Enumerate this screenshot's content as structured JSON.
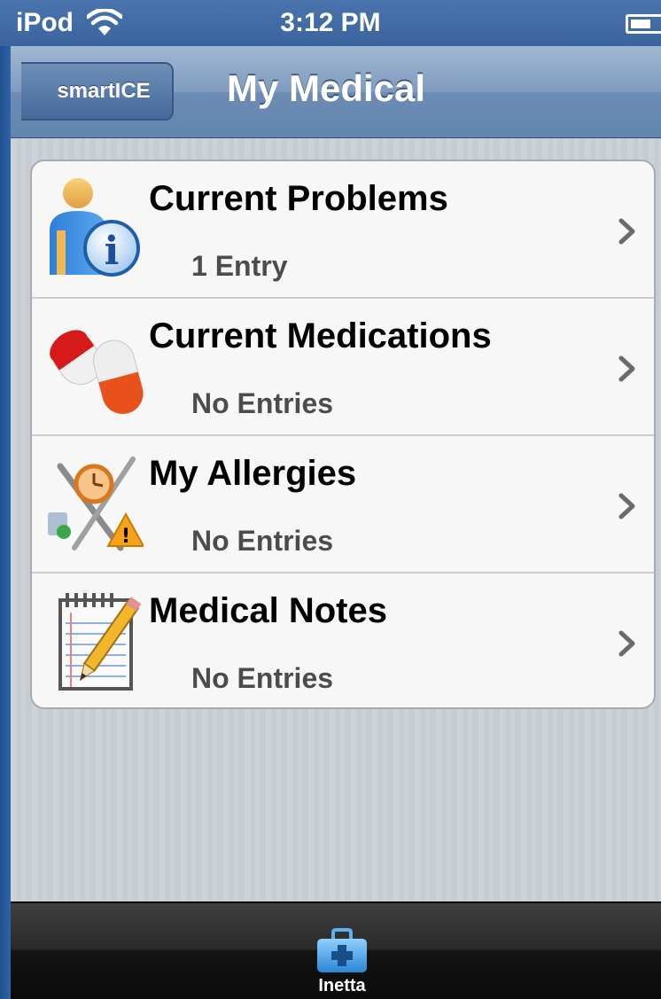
{
  "status_bar": {
    "carrier": "iPod",
    "time": "3:12 PM"
  },
  "nav": {
    "back_label": "smartICE",
    "title": "My Medical"
  },
  "rows": [
    {
      "title": "Current Problems",
      "subtitle": "1 Entry",
      "icon": "person-info-icon"
    },
    {
      "title": "Current Medications",
      "subtitle": "No Entries",
      "icon": "pills-icon"
    },
    {
      "title": "My Allergies",
      "subtitle": "No Entries",
      "icon": "allergy-icon"
    },
    {
      "title": "Medical Notes",
      "subtitle": "No Entries",
      "icon": "notepad-icon"
    }
  ],
  "tab_bar": {
    "items": [
      {
        "label": "Inetta",
        "icon": "medical-kit-icon"
      }
    ]
  },
  "colors": {
    "nav_bar": "#6d8cb4",
    "background": "#c6ccd4",
    "tab_bar": "#1a1a1a",
    "tab_icon": "#4aa8e8"
  }
}
